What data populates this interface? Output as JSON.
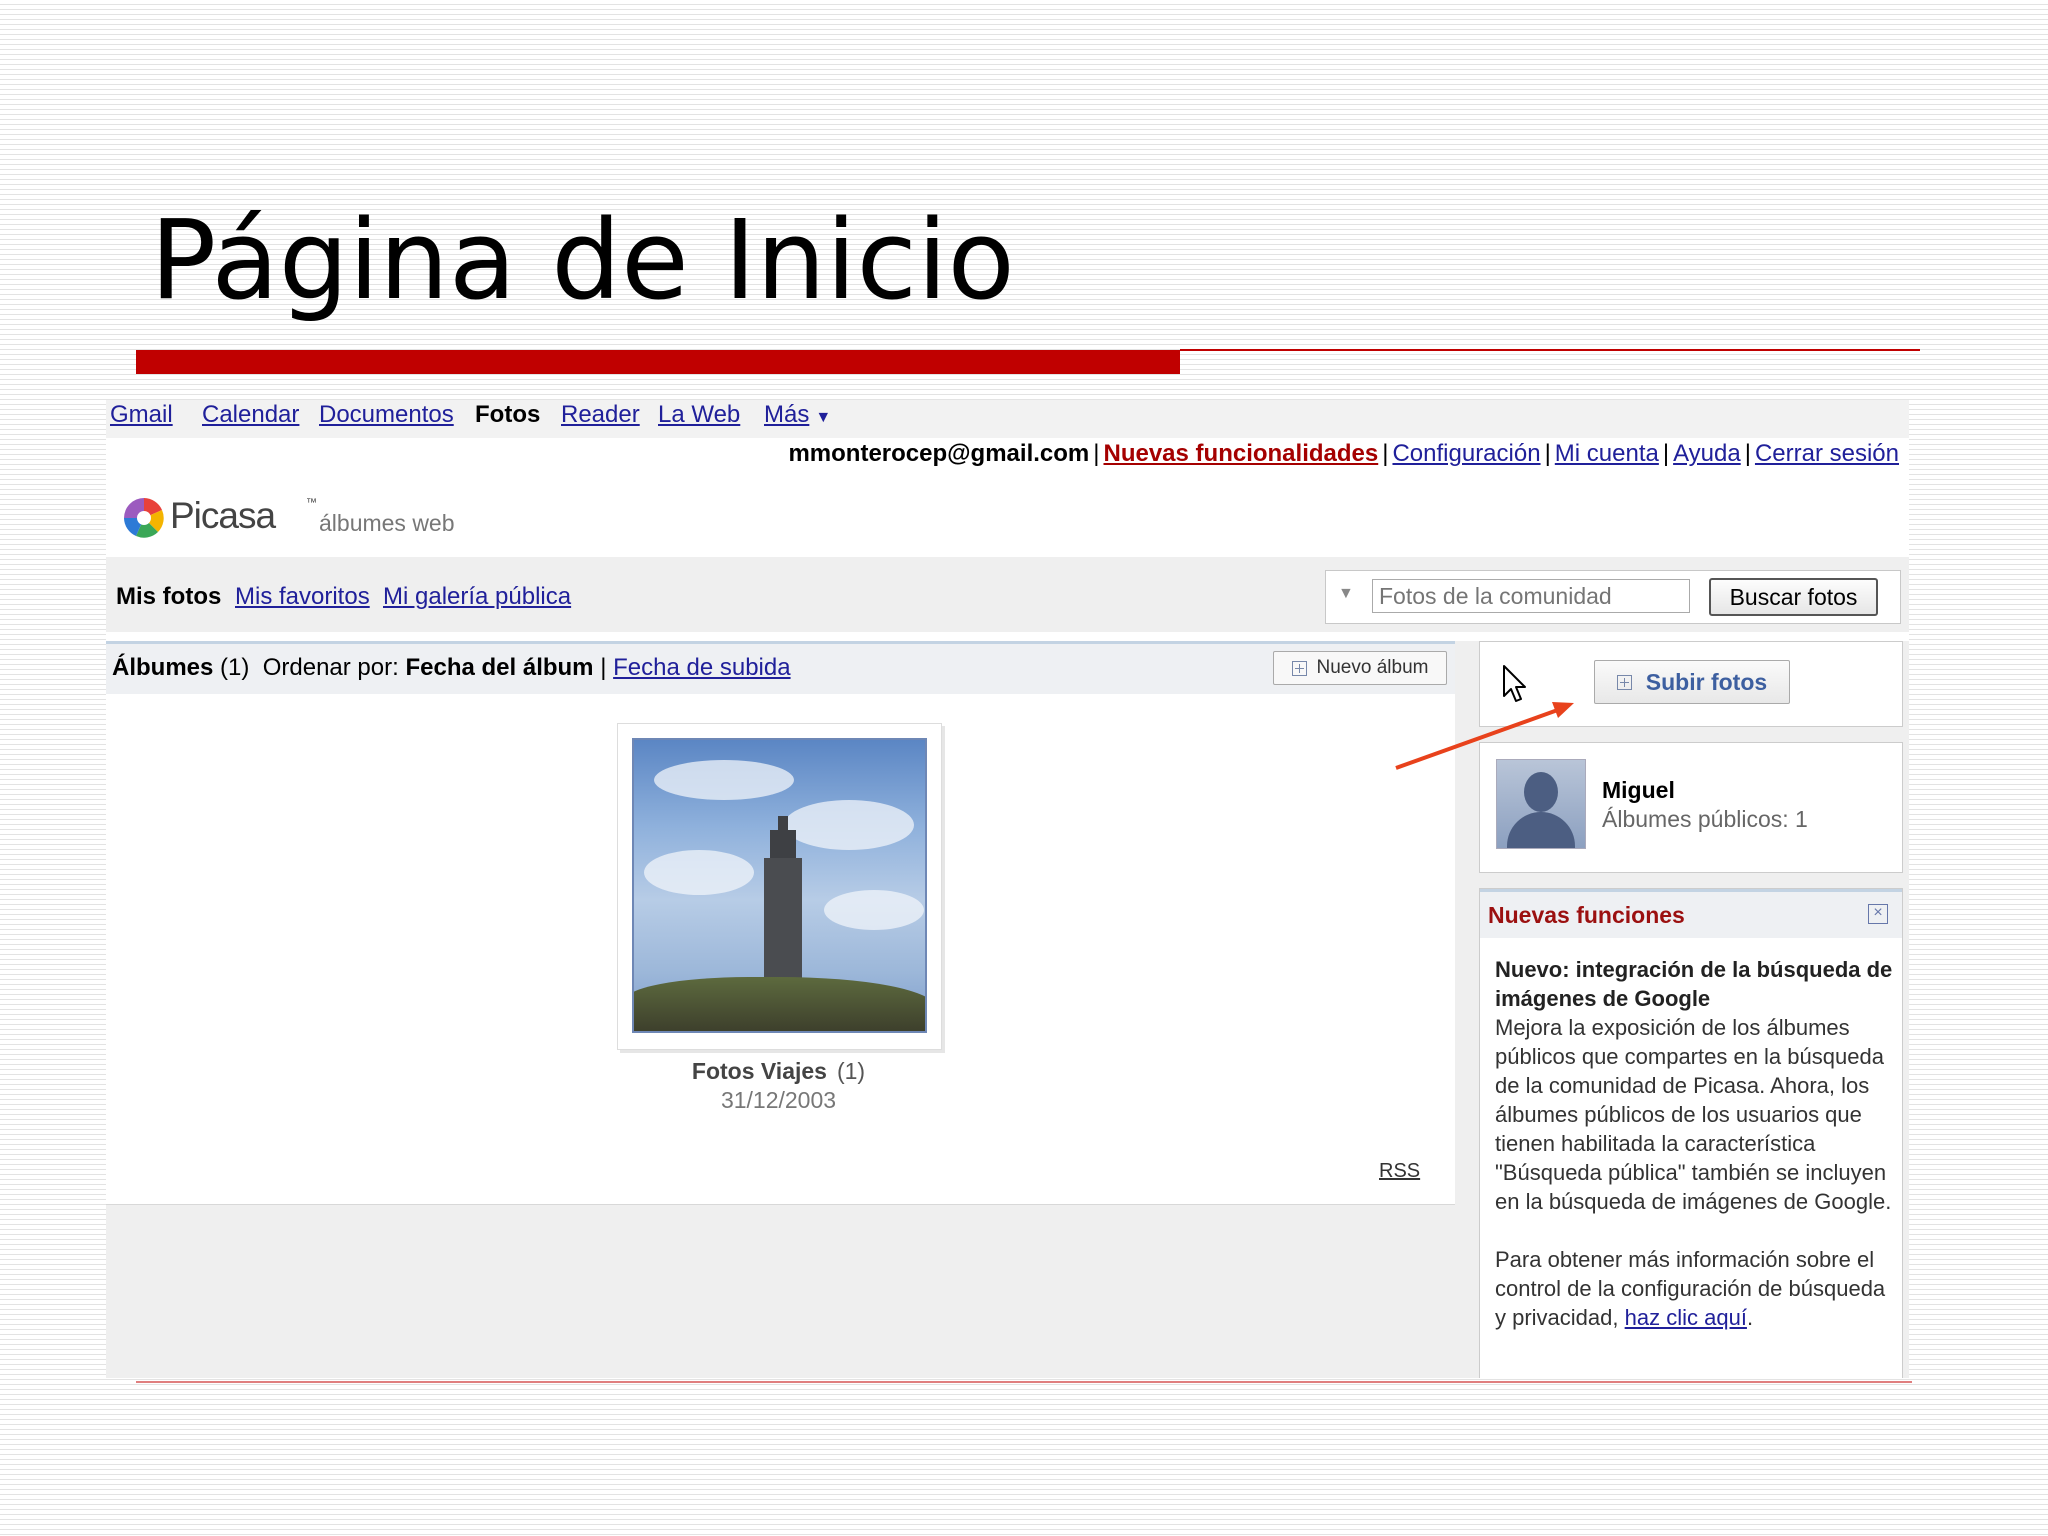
{
  "slide": {
    "title": "Página de Inicio"
  },
  "gbar": {
    "items": [
      "Gmail",
      "Calendar",
      "Documentos",
      "Fotos",
      "Reader",
      "La Web",
      "Más"
    ]
  },
  "userbar": {
    "email": "mmonterocep@gmail.com",
    "new_features": "Nuevas funcionalidades",
    "settings": "Configuración",
    "account": "Mi cuenta",
    "help": "Ayuda",
    "signout": "Cerrar sesión"
  },
  "logo": {
    "name": "Picasa",
    "tm": "™",
    "subtitle": "álbumes web"
  },
  "nav": {
    "mis_fotos": "Mis fotos",
    "favoritos": "Mis favoritos",
    "galeria": "Mi galería pública",
    "search_placeholder": "Fotos de la comunidad",
    "search_button": "Buscar fotos"
  },
  "albums_bar": {
    "label": "Álbumes",
    "count": "(1)",
    "sort_label": "Ordenar por:",
    "sort_active": "Fecha del álbum",
    "sort_other": "Fecha de subida",
    "new_album": "Nuevo álbum"
  },
  "album": {
    "title": "Fotos Viajes",
    "count": "(1)",
    "date": "31/12/2003"
  },
  "rss": "RSS",
  "upload": {
    "button": "Subir fotos"
  },
  "user": {
    "name": "Miguel",
    "public_albums": "Álbumes públicos: 1"
  },
  "news": {
    "title": "Nuevas funciones",
    "heading": "Nuevo: integración de la búsqueda de imágenes de Google",
    "body1": "Mejora la exposición de los álbumes públicos que compartes en la búsqueda de la comunidad de Picasa. Ahora, los álbumes públicos de los usuarios que tienen habilitada la característica \"Búsqueda pública\" también se incluyen en la búsqueda de imágenes de Google.",
    "body2": "Para obtener más información sobre el control de la configuración de búsqueda y privacidad,",
    "link": "haz clic aquí",
    "end": "."
  },
  "colors": {
    "accent_red": "#c00000",
    "link": "#20209a",
    "news_title": "#9b1010"
  }
}
